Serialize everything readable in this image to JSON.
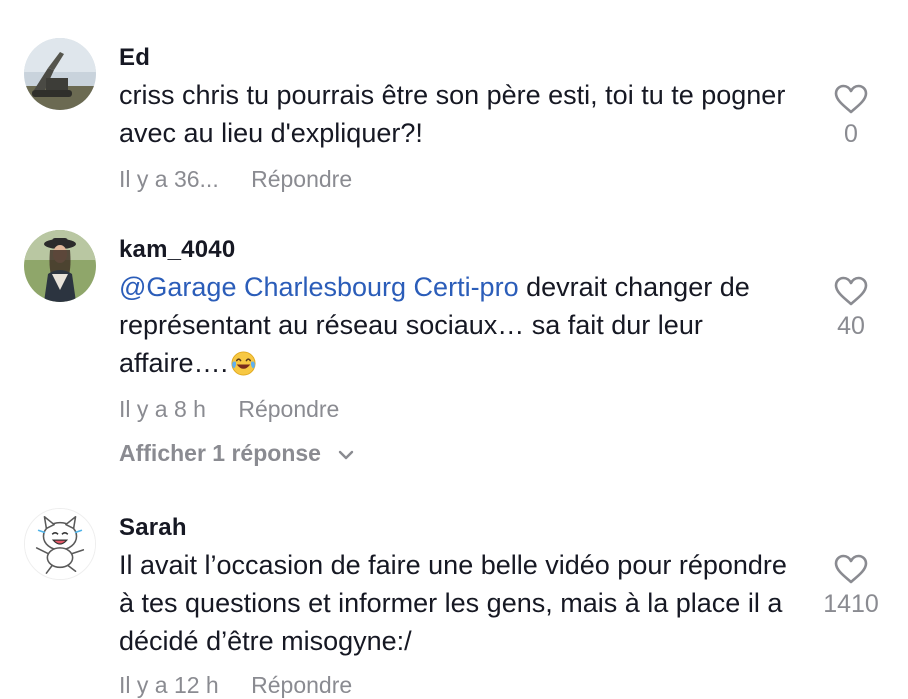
{
  "comments": [
    {
      "username": "Ed",
      "text": "criss chris tu pourrais être son père esti, toi tu te pogner avec au lieu d'expliquer?!",
      "timestamp": "Il y a 36...",
      "reply_label": "Répondre",
      "likes": "0"
    },
    {
      "username": "kam_4040",
      "mention": "@Garage Charlesbourg Certi-pro",
      "text": " devrait changer de représentant au réseau sociaux… sa fait dur leur affaire….",
      "emoji": "face-with-tears-of-joy",
      "timestamp": "Il y a 8 h",
      "reply_label": "Répondre",
      "likes": "40",
      "view_replies_label": "Afficher 1 réponse"
    },
    {
      "username": "Sarah",
      "text": "Il avait l’occasion de faire une belle vidéo pour répondre à tes questions et informer les gens, mais à la place il a décidé d’être misogyne:/",
      "timestamp": "Il y a 12 h",
      "reply_label": "Répondre",
      "likes": "1410"
    }
  ],
  "colors": {
    "text": "#161823",
    "secondary": "#8a8b91",
    "mention": "#2b5db9"
  }
}
